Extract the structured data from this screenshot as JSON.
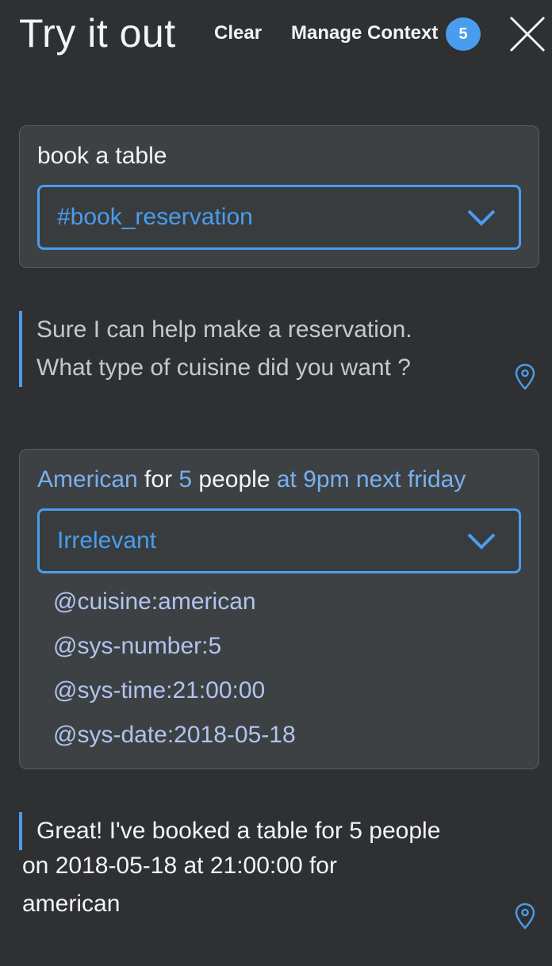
{
  "header": {
    "title": "Try it out",
    "clear_label": "Clear",
    "manage_label": "Manage Context",
    "context_count": "5"
  },
  "messages": [
    {
      "user_text": "book a table",
      "intent": "#book_reservation",
      "bot_lines": [
        "Sure I can help make a reservation.",
        "What type of cuisine did you want ?"
      ]
    },
    {
      "user_parts": [
        {
          "text": "American",
          "entity": true
        },
        {
          "text": " for ",
          "entity": false
        },
        {
          "text": "5",
          "entity": true
        },
        {
          "text": " people",
          "entity": false
        },
        {
          "text": " at 9pm next friday",
          "entity": true
        }
      ],
      "intent": "Irrelevant",
      "entities": [
        "@cuisine:american",
        "@sys-number:5",
        "@sys-time:21:00:00",
        "@sys-date:2018-05-18"
      ],
      "bot_lines": [
        "Great! I've booked a table for 5 people",
        "on 2018-05-18 at 21:00:00 for",
        "american"
      ]
    }
  ],
  "colors": {
    "background": "#2f3031",
    "card": "#3d4143",
    "accent": "#4a9ded",
    "entity_text": "#b2c4ee"
  },
  "icons": [
    "close-icon",
    "chevron-down-icon",
    "location-pin-icon"
  ]
}
